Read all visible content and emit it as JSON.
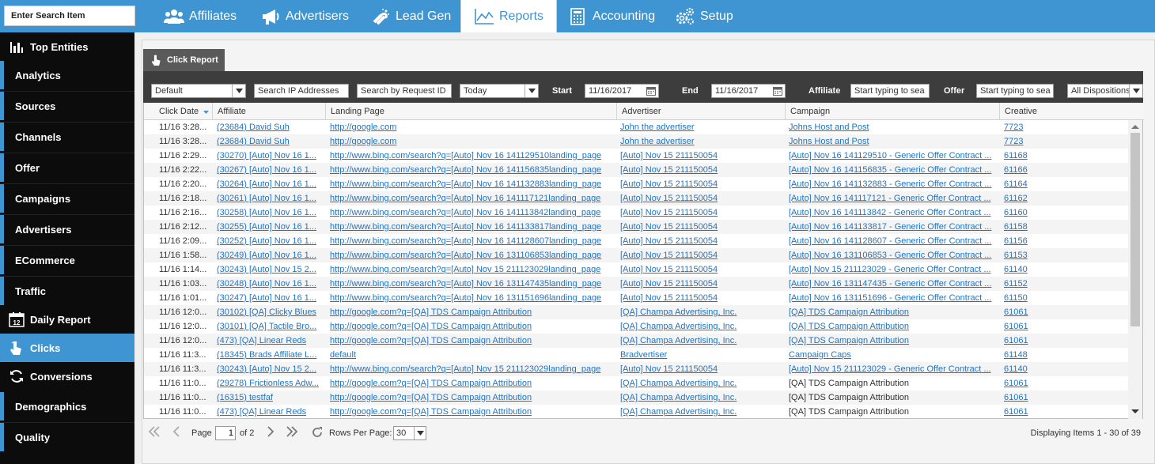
{
  "search": {
    "placeholder": "Enter Search Item"
  },
  "nav": {
    "tabs": [
      {
        "label": "Affiliates",
        "icon": "users-icon"
      },
      {
        "label": "Advertisers",
        "icon": "megaphone-icon"
      },
      {
        "label": "Lead Gen",
        "icon": "magnet-icon"
      },
      {
        "label": "Reports",
        "icon": "line-chart-icon",
        "active": true
      },
      {
        "label": "Accounting",
        "icon": "calculator-icon"
      },
      {
        "label": "Setup",
        "icon": "gears-icon"
      }
    ]
  },
  "sidebar": {
    "items": [
      {
        "label": "Top Entities",
        "icon": "bar-chart-icon"
      },
      {
        "label": "Analytics"
      },
      {
        "label": "Sources"
      },
      {
        "label": "Channels"
      },
      {
        "label": "Offer"
      },
      {
        "label": "Campaigns"
      },
      {
        "label": "Advertisers"
      },
      {
        "label": "ECommerce"
      },
      {
        "label": "Traffic"
      },
      {
        "label": "Daily Report",
        "icon": "calendar-icon",
        "icon_text": "12"
      },
      {
        "label": "Clicks",
        "icon": "pointer-icon",
        "active": true
      },
      {
        "label": "Conversions",
        "icon": "refresh-icon"
      },
      {
        "label": "Demographics"
      },
      {
        "label": "Quality"
      }
    ]
  },
  "report": {
    "tab_label": "Click Report",
    "filters": {
      "view": "Default",
      "ip_placeholder": "Search IP Addresses",
      "request_placeholder": "Search by Request ID",
      "range": "Today",
      "start_label": "Start",
      "start_date": "11/16/2017",
      "end_label": "End",
      "end_date": "11/16/2017",
      "affiliate_label": "Affiliate",
      "affiliate_placeholder": "Start typing to sea",
      "offer_label": "Offer",
      "offer_placeholder": "Start typing to sea",
      "disposition": "All Dispositions"
    },
    "columns": [
      "Click Date",
      "Affiliate",
      "Landing Page",
      "Advertiser",
      "Campaign",
      "Creative"
    ],
    "rows": [
      [
        "11/16 3:28...",
        "(23684) David Suh",
        "http://google.com",
        "John the advertiser",
        "Johns Host and Post",
        "7723",
        true
      ],
      [
        "11/16 3:28...",
        "(23684) David Suh",
        "http://google.com",
        "John the advertiser",
        "Johns Host and Post",
        "7723",
        true
      ],
      [
        "11/16 2:29...",
        "(30270) [Auto] Nov 16 1...",
        "http://www.bing.com/search?q=[Auto] Nov 16 141129510landing_page",
        "[Auto] Nov 15 211150054",
        "[Auto] Nov 16 141129510 - Generic Offer Contract ...",
        "61168",
        true
      ],
      [
        "11/16 2:22...",
        "(30267) [Auto] Nov 16 1...",
        "http://www.bing.com/search?q=[Auto] Nov 16 141156835landing_page",
        "[Auto] Nov 15 211150054",
        "[Auto] Nov 16 141156835 - Generic Offer Contract ...",
        "61166",
        true
      ],
      [
        "11/16 2:20...",
        "(30264) [Auto] Nov 16 1...",
        "http://www.bing.com/search?q=[Auto] Nov 16 141132883landing_page",
        "[Auto] Nov 15 211150054",
        "[Auto] Nov 16 141132883 - Generic Offer Contract ...",
        "61164",
        true
      ],
      [
        "11/16 2:18...",
        "(30261) [Auto] Nov 16 1...",
        "http://www.bing.com/search?q=[Auto] Nov 16 141117121landing_page",
        "[Auto] Nov 15 211150054",
        "[Auto] Nov 16 141117121 - Generic Offer Contract ...",
        "61162",
        true
      ],
      [
        "11/16 2:16...",
        "(30258) [Auto] Nov 16 1...",
        "http://www.bing.com/search?q=[Auto] Nov 16 141113842landing_page",
        "[Auto] Nov 15 211150054",
        "[Auto] Nov 16 141113842 - Generic Offer Contract ...",
        "61160",
        true
      ],
      [
        "11/16 2:12...",
        "(30255) [Auto] Nov 16 1...",
        "http://www.bing.com/search?q=[Auto] Nov 16 141133817landing_page",
        "[Auto] Nov 15 211150054",
        "[Auto] Nov 16 141133817 - Generic Offer Contract ...",
        "61158",
        true
      ],
      [
        "11/16 2:09...",
        "(30252) [Auto] Nov 16 1...",
        "http://www.bing.com/search?q=[Auto] Nov 16 141128607landing_page",
        "[Auto] Nov 15 211150054",
        "[Auto] Nov 16 141128607 - Generic Offer Contract ...",
        "61156",
        true
      ],
      [
        "11/16 1:58...",
        "(30249) [Auto] Nov 16 1...",
        "http://www.bing.com/search?q=[Auto] Nov 16 131106853landing_page",
        "[Auto] Nov 15 211150054",
        "[Auto] Nov 16 131106853 - Generic Offer Contract ...",
        "61153",
        true
      ],
      [
        "11/16 1:14...",
        "(30243) [Auto] Nov 15 2...",
        "http://www.bing.com/search?q=[Auto] Nov 15 211123029landing_page",
        "[Auto] Nov 15 211150054",
        "[Auto] Nov 15 211123029 - Generic Offer Contract ...",
        "61140",
        true
      ],
      [
        "11/16 1:03...",
        "(30248) [Auto] Nov 16 1...",
        "http://www.bing.com/search?q=[Auto] Nov 16 131147435landing_page",
        "[Auto] Nov 15 211150054",
        "[Auto] Nov 16 131147435 - Generic Offer Contract ...",
        "61152",
        true
      ],
      [
        "11/16 1:01...",
        "(30247) [Auto] Nov 16 1...",
        "http://www.bing.com/search?q=[Auto] Nov 16 131151696landing_page",
        "[Auto] Nov 15 211150054",
        "[Auto] Nov 16 131151696 - Generic Offer Contract ...",
        "61150",
        true
      ],
      [
        "11/16 12:0...",
        "(30102) [QA] Clicky Blues",
        "http://google.com?q=[QA] TDS Campaign Attribution",
        "[QA] Champa Advertising, Inc.",
        "[QA] TDS Campaign Attribution",
        "61061",
        true
      ],
      [
        "11/16 12:0...",
        "(30101) [QA] Tactile Bro...",
        "http://google.com?q=[QA] TDS Campaign Attribution",
        "[QA] Champa Advertising, Inc.",
        "[QA] TDS Campaign Attribution",
        "61061",
        true
      ],
      [
        "11/16 12:0...",
        "(473) [QA] Linear Reds",
        "http://google.com?q=[QA] TDS Campaign Attribution",
        "[QA] Champa Advertising, Inc.",
        "[QA] TDS Campaign Attribution",
        "61061",
        true
      ],
      [
        "11/16 11:3...",
        "(18345) Brads Affiliate L...",
        "default",
        "Bradvertiser",
        "Campaign Caps",
        "61148",
        true
      ],
      [
        "11/16 11:3...",
        "(30243) [Auto] Nov 15 2...",
        "http://www.bing.com/search?q=[Auto] Nov 15 211123029landing_page",
        "[Auto] Nov 15 211150054",
        "[Auto] Nov 15 211123029 - Generic Offer Contract ...",
        "61140",
        true
      ],
      [
        "11/16 11:0...",
        "(29278) Frictionless Adw...",
        "http://google.com?q=[QA] TDS Campaign Attribution",
        "[QA] Champa Advertising, Inc.",
        "[QA] TDS Campaign Attribution",
        "61061",
        false
      ],
      [
        "11/16 11:0...",
        "(16315) testfaf",
        "http://google.com?q=[QA] TDS Campaign Attribution",
        "[QA] Champa Advertising, Inc.",
        "[QA] TDS Campaign Attribution",
        "61061",
        false
      ],
      [
        "11/16 11:0...",
        "(473) [QA] Linear Reds",
        "http://google.com?q=[QA] TDS Campaign Attribution",
        "[QA] Champa Advertising, Inc.",
        "[QA] TDS Campaign Attribution",
        "61061",
        false
      ]
    ],
    "pager": {
      "page_label": "Page",
      "current_page": "1",
      "of_label": "of 2",
      "rows_label": "Rows Per Page:",
      "rows_per_page": "30",
      "status": "Displaying Items 1 - 30 of 39"
    }
  },
  "colors": {
    "accent": "#3e95d1",
    "link": "#1f74c5",
    "sidebar_bg": "#0c0c0c",
    "filterbar_bg": "#3d3d3d"
  }
}
